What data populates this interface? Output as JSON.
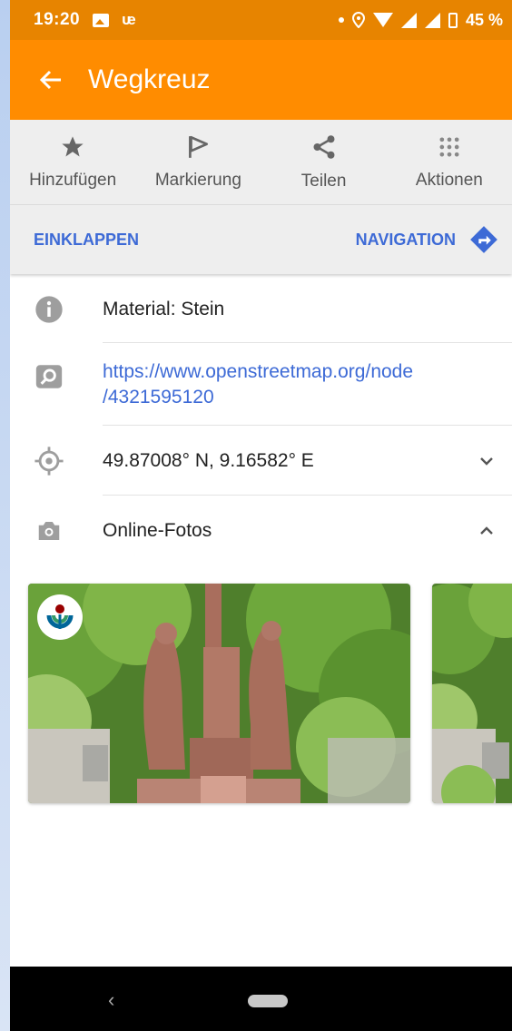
{
  "status_bar": {
    "time": "19:20",
    "battery": "45 %"
  },
  "app_bar": {
    "title": "Wegkreuz"
  },
  "actions": [
    {
      "label": "Hinzufügen",
      "icon": "star-icon"
    },
    {
      "label": "Markierung",
      "icon": "flag-icon"
    },
    {
      "label": "Teilen",
      "icon": "share-icon"
    },
    {
      "label": "Aktionen",
      "icon": "grid-dots-icon"
    }
  ],
  "toolbar": {
    "collapse_label": "EINKLAPPEN",
    "navigation_label": "NAVIGATION"
  },
  "details": {
    "material": "Material: Stein",
    "link_line1": "https://www.openstreetmap.org/node",
    "link_line2": "/4321595120",
    "coordinates": "49.87008° N, 9.16582° E",
    "photos_label": "Online-Fotos"
  },
  "colors": {
    "status_bar": "#e78400",
    "app_bar": "#ff8c00",
    "link": "#3d6ad6"
  }
}
